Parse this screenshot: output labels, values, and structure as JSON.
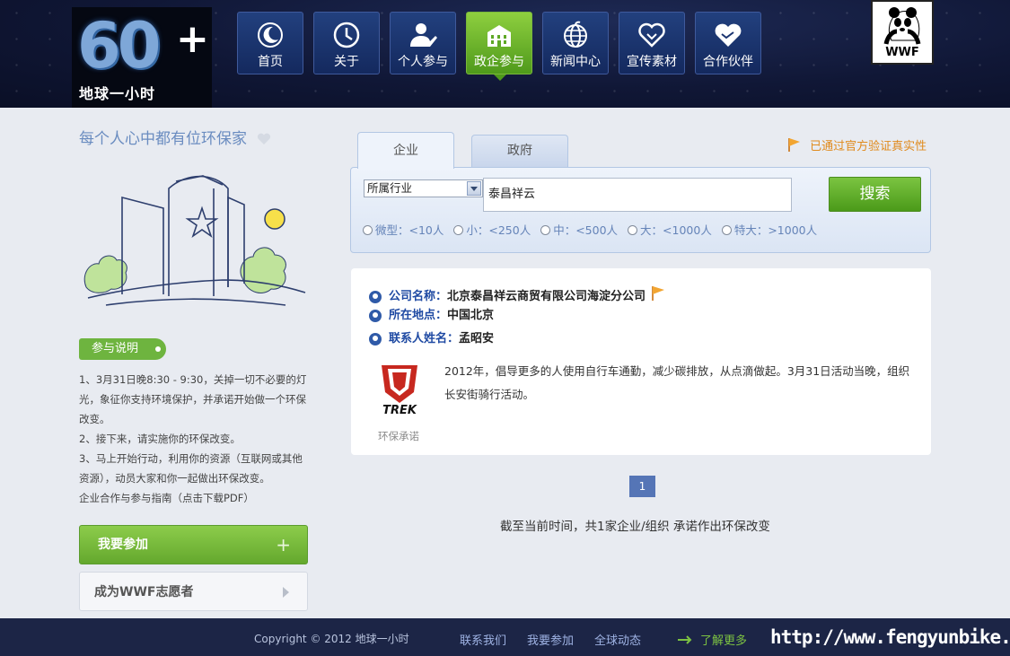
{
  "header": {
    "logo_number": "60",
    "logo_plus": "+",
    "logo_text": "地球一小时",
    "partner_logo_text": "WWF",
    "nav": [
      {
        "label": "首页",
        "icon": "moon-icon"
      },
      {
        "label": "关于",
        "icon": "clock-icon"
      },
      {
        "label": "个人参与",
        "icon": "person-icon"
      },
      {
        "label": "政企参与",
        "icon": "building-icon",
        "active": true
      },
      {
        "label": "新闻中心",
        "icon": "globe-icon"
      },
      {
        "label": "宣传素材",
        "icon": "heart-icon"
      },
      {
        "label": "合作伙伴",
        "icon": "handshake-icon"
      }
    ]
  },
  "sidebar": {
    "slogan": "每个人心中都有位环保家",
    "guide_tag": "参与说明",
    "steps": [
      "1、3月31日晚8:30 - 9:30，关掉一切不必要的灯光，象征你支持环境保护，并承诺开始做一个环保改变。",
      "2、接下来，请实施你的环保改变。",
      "3、马上开始行动，利用你的资源（互联网或其他资源），动员大家和你一起做出环保改变。",
      "企业合作与参与指南（点击下载PDF）"
    ],
    "join_button": "我要参加",
    "join_button_symbol": "+",
    "volunteer_button": "成为WWF志愿者"
  },
  "search": {
    "tabs": [
      "企业",
      "政府"
    ],
    "active_tab": "企业",
    "verified_text": "已通过官方验证真实性",
    "industry_select": "所属行业",
    "keyword": "泰昌祥云",
    "button": "搜索",
    "sizes": [
      "微型：<10人",
      "小：<250人",
      "中：<500人",
      "大：<1000人",
      "特大：>1000人"
    ]
  },
  "result": {
    "company_label": "公司名称：",
    "company": "北京泰昌祥云商贸有限公司海淀分公司",
    "location_label": "所在地点：",
    "location": "中国北京",
    "contact_label": "联系人姓名：",
    "contact": "孟昭安",
    "brand_logo_text": "TREK",
    "pledge_label": "环保承诺",
    "description": "2012年，倡导更多的人使用自行车通勤，减少碳排放，从点滴做起。3月31日活动当晚，组织长安街骑行活动。"
  },
  "pagination": {
    "current": "1"
  },
  "summary": "截至当前时间，共1家企业/组织 承诺作出环保改变",
  "footer": {
    "copyright": "Copyright © 2012 地球一小时",
    "links": [
      "联系我们",
      "我要参加",
      "全球动态"
    ],
    "more": "了解更多",
    "watermark": "http://www.fengyunbike.com"
  },
  "colors": {
    "accent_green": "#6eb43f",
    "nav_blue": "#1a3470",
    "link_blue": "#1f4aa3",
    "flag_orange": "#e08a1c"
  }
}
